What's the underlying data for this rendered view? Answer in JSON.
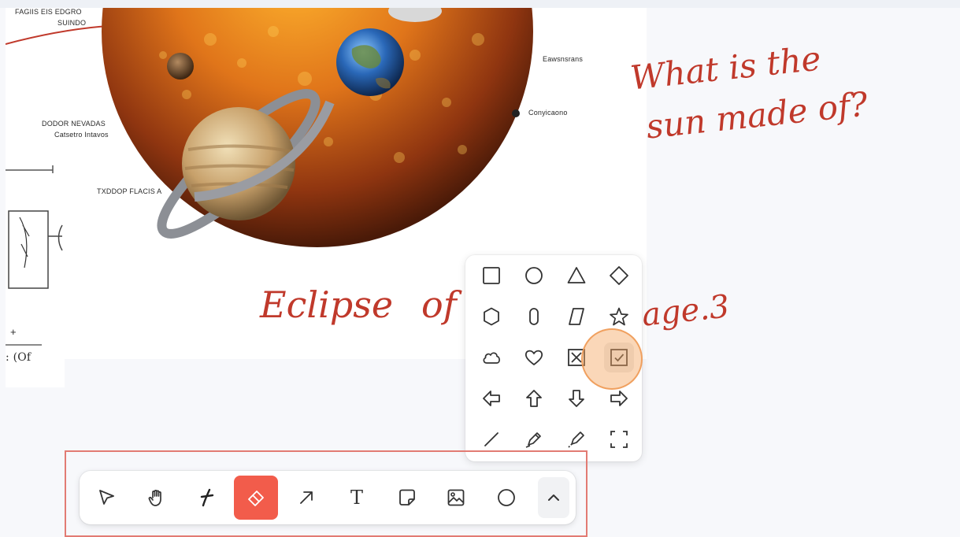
{
  "canvas": {
    "diagram_labels": [
      "FAGIIS EIS EDGRO",
      "SUINDO",
      "DODOR NEVADAS",
      "Catsetro Intavos",
      "TXDDOP FLACIS A",
      "Eawsnsrans",
      "Conyicaono",
      "+",
      ": (Of"
    ],
    "handwriting": {
      "question_line1": "What is the",
      "question_line2": "sun made of?",
      "eclipse_part1": "Eclipse",
      "eclipse_part2": "of",
      "eclipse_part3": "age.3"
    }
  },
  "shape_picker": {
    "shapes": [
      "rectangle-icon",
      "ellipse-icon",
      "triangle-icon",
      "diamond-icon",
      "hexagon-icon",
      "oval-icon",
      "parallelogram-icon",
      "star-icon",
      "cloud-icon",
      "heart-icon",
      "x-box-icon",
      "check-box-icon",
      "arrow-left-icon",
      "arrow-up-icon",
      "arrow-down-icon",
      "arrow-right-icon",
      "line-icon",
      "pencil-icon",
      "highlighter-icon",
      "frame-icon"
    ],
    "selected": "check-box-icon"
  },
  "toolbar": {
    "tools": [
      "select-tool",
      "hand-tool",
      "draw-tool",
      "eraser-tool",
      "arrow-tool",
      "text-tool",
      "note-tool",
      "image-tool",
      "shape-tool",
      "more-tools"
    ],
    "active_tool": "eraser-tool",
    "text_tool_glyph": "T"
  },
  "colors": {
    "accent": "#f25c4b",
    "handwriting": "#c0392b",
    "highlight_ring": "#f5a662",
    "annotation_box": "#e27b73"
  }
}
